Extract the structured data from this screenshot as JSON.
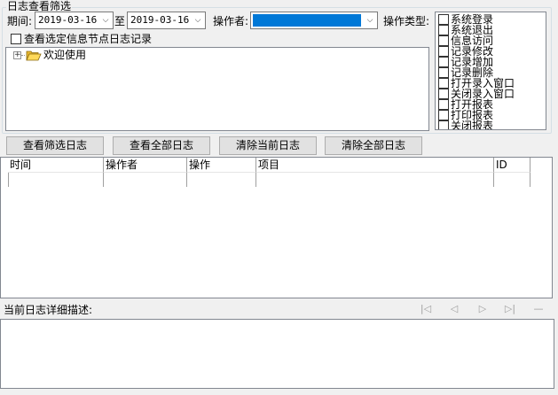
{
  "filter": {
    "group_title": "日志查看筛选",
    "period_label": "期间:",
    "date_from": "2019-03-16",
    "to_label": "至",
    "date_to": "2019-03-16",
    "operator_label": "操作者:",
    "op_type_label": "操作类型:",
    "view_selected_node_label": "查看选定信息节点日志记录",
    "tree_root": "欢迎使用",
    "op_types": [
      "系统登录",
      "系统退出",
      "信息访问",
      "记录修改",
      "记录增加",
      "记录删除",
      "打开录入窗口",
      "关闭录入窗口",
      "打开报表",
      "打印报表",
      "关闭报表"
    ]
  },
  "buttons": {
    "view_filtered": "查看筛选日志",
    "view_all": "查看全部日志",
    "clear_current": "清除当前日志",
    "clear_all": "清除全部日志"
  },
  "log_table": {
    "columns": [
      "时间",
      "操作者",
      "操作",
      "项目",
      "ID"
    ]
  },
  "detail": {
    "label": "当前日志详细描述:"
  },
  "nav": {
    "first": "|◁",
    "prev": "◁",
    "next": "▷",
    "last": "▷|",
    "extra": "—"
  }
}
